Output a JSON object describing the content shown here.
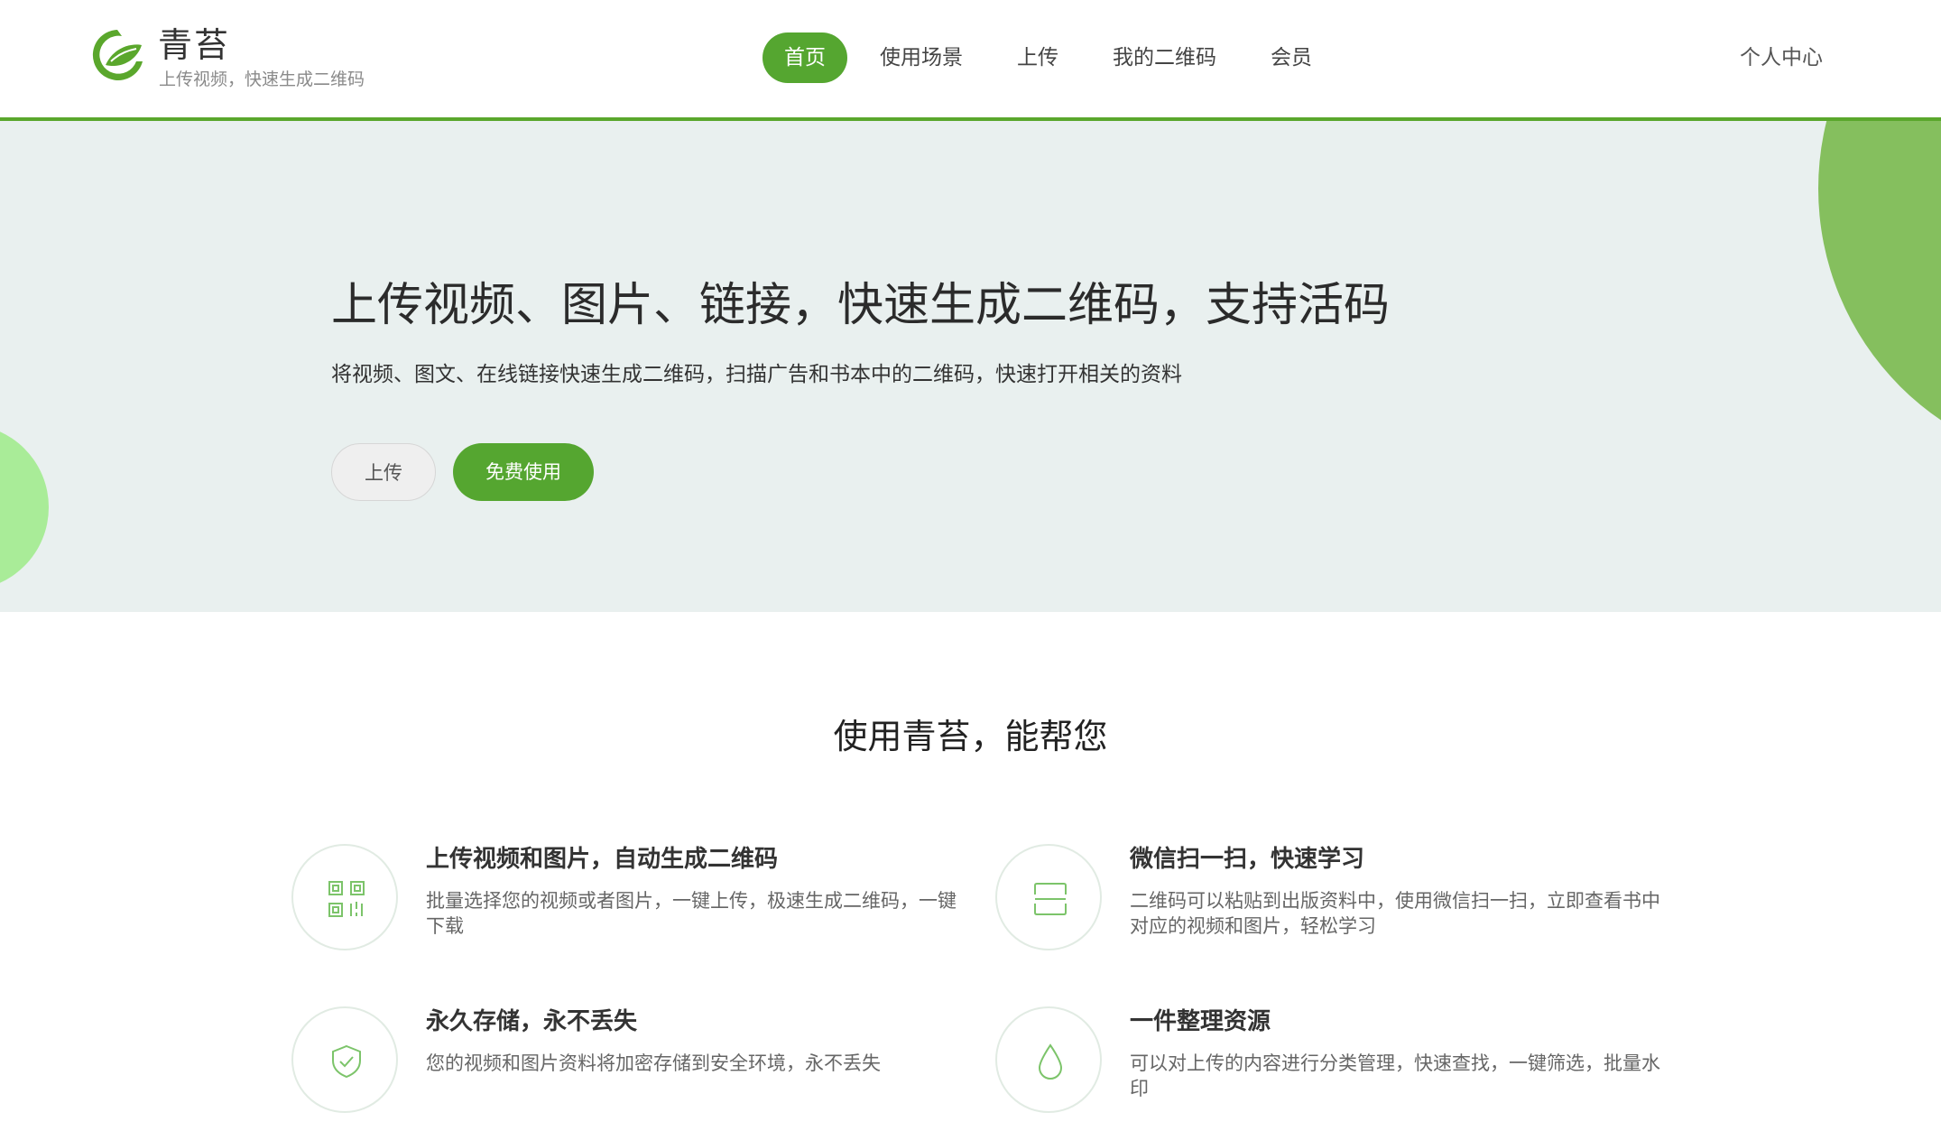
{
  "brand": {
    "name": "青苔",
    "tagline": "上传视频，快速生成二维码",
    "logo_icon": "leaf-logo-icon",
    "accent_color": "#55a630"
  },
  "nav": {
    "items": [
      {
        "label": "首页",
        "active": true
      },
      {
        "label": "使用场景",
        "active": false
      },
      {
        "label": "上传",
        "active": false
      },
      {
        "label": "我的二维码",
        "active": false
      },
      {
        "label": "会员",
        "active": false
      }
    ],
    "user_center": "个人中心"
  },
  "hero": {
    "title": "上传视频、图片、链接，快速生成二维码，支持活码",
    "subtitle": "将视频、图文、在线链接快速生成二维码，扫描广告和书本中的二维码，快速打开相关的资料",
    "upload_button": "上传",
    "free_button": "免费使用",
    "background_color": "#e9f0ef"
  },
  "features": {
    "section_title": "使用青苔，能帮您",
    "items": [
      {
        "icon": "qr-code-icon",
        "title": "上传视频和图片，自动生成二维码",
        "desc": "批量选择您的视频或者图片，一键上传，极速生成二维码，一键下载"
      },
      {
        "icon": "scan-icon",
        "title": "微信扫一扫，快速学习",
        "desc": "二维码可以粘贴到出版资料中，使用微信扫一扫，立即查看书中对应的视频和图片，轻松学习"
      },
      {
        "icon": "shield-check-icon",
        "title": "永久存储，永不丢失",
        "desc": "您的视频和图片资料将加密存储到安全环境，永不丢失"
      },
      {
        "icon": "drop-icon",
        "title": "一件整理资源",
        "desc": "可以对上传的内容进行分类管理，快速查找，一键筛选，批量水印"
      }
    ]
  }
}
